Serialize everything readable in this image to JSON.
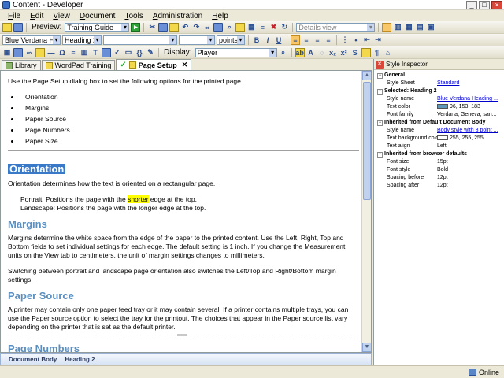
{
  "window": {
    "title": "Content - Developer"
  },
  "menu": [
    {
      "pre": "",
      "u": "F",
      "post": "ile"
    },
    {
      "pre": "",
      "u": "E",
      "post": "dit"
    },
    {
      "pre": "",
      "u": "V",
      "post": "iew"
    },
    {
      "pre": "",
      "u": "D",
      "post": "ocument"
    },
    {
      "pre": "",
      "u": "T",
      "post": "ools"
    },
    {
      "pre": "",
      "u": "A",
      "post": "dministration"
    },
    {
      "pre": "",
      "u": "H",
      "post": "elp"
    }
  ],
  "toolbar": {
    "preview_label": "Preview:",
    "preview_value": "Training Guide",
    "views_value": "Details view",
    "font_value": "Blue Verdana Headi...",
    "style_value": "Heading 2",
    "units_value": "points",
    "display_label": "Display:",
    "display_value": "Player",
    "bold": "B",
    "italic": "I",
    "underline": "U"
  },
  "tabs": [
    {
      "label": "Library",
      "active": false
    },
    {
      "label": "WordPad Training",
      "active": false
    },
    {
      "label": "Page Setup",
      "active": true
    }
  ],
  "document": {
    "intro": "Use the Page Setup dialog box to set the following options for the printed page.",
    "bullets": [
      "Orientation",
      "Margins",
      "Paper Source",
      "Page Numbers",
      "Paper Size"
    ],
    "orientation_heading": "Orientation",
    "orientation_text": "Orientation determines how the text is oriented on a rectangular page.",
    "portrait_pre": "Portrait: Positions the page with the ",
    "portrait_hl": "shorter",
    "portrait_post": " edge at the top.",
    "landscape": "Landscape: Positions the page with the longer edge at the top.",
    "margins_heading": "Margins",
    "margins_text": "Margins determine the white space from the edge of the paper to the printed content. Use the Left, Right, Top and Bottom fields to set individual settings for each edge. The default setting is 1 inch. If you change the Measurement units on the View tab to centimeters, the unit of margin settings changes to millimeters.",
    "margins_text2": "Switching between portrait and landscape page orientation also switches the Left/Top and Right/Bottom margin settings.",
    "paper_heading": "Paper Source",
    "paper_text": "A printer may contain only one paper feed tray or it may contain several. If a printer contains multiple trays, you can use the Paper source option to select the tray for the printout. The choices that appear in the Paper source list vary depending on the printer that is set as the default printer.",
    "pagenum_heading": "Page Numbers"
  },
  "breadcrumb": [
    "Document Body",
    "Heading 2"
  ],
  "inspector": {
    "title": "Style Inspector",
    "groups": [
      {
        "label": "General",
        "rows": [
          {
            "name": "Style Sheet",
            "value": "Standard",
            "link": true
          }
        ]
      },
      {
        "label": "Selected: Heading 2",
        "rows": [
          {
            "name": "Style name",
            "value": "Blue Verdana Heading ...",
            "link": true
          },
          {
            "name": "Text color",
            "value": "96, 153, 183",
            "swatch": "#6099b7"
          },
          {
            "name": "Font family",
            "value": "Verdana, Geneva, san..."
          }
        ]
      },
      {
        "label": "Inherited from Default Document Body",
        "rows": [
          {
            "name": "Style name",
            "value": "Body style with 8 point ...",
            "link": true
          },
          {
            "name": "Text background color",
            "value": "255, 255, 255",
            "swatch": "#ffffff"
          },
          {
            "name": "Text align",
            "value": "Left"
          }
        ]
      },
      {
        "label": "Inherited from browser defaults",
        "rows": [
          {
            "name": "Font size",
            "value": "15pt"
          },
          {
            "name": "Font style",
            "value": "Bold"
          },
          {
            "name": "Spacing before",
            "value": "12pt"
          },
          {
            "name": "Spacing after",
            "value": "12pt"
          }
        ]
      }
    ]
  },
  "status": {
    "text": "Online"
  }
}
